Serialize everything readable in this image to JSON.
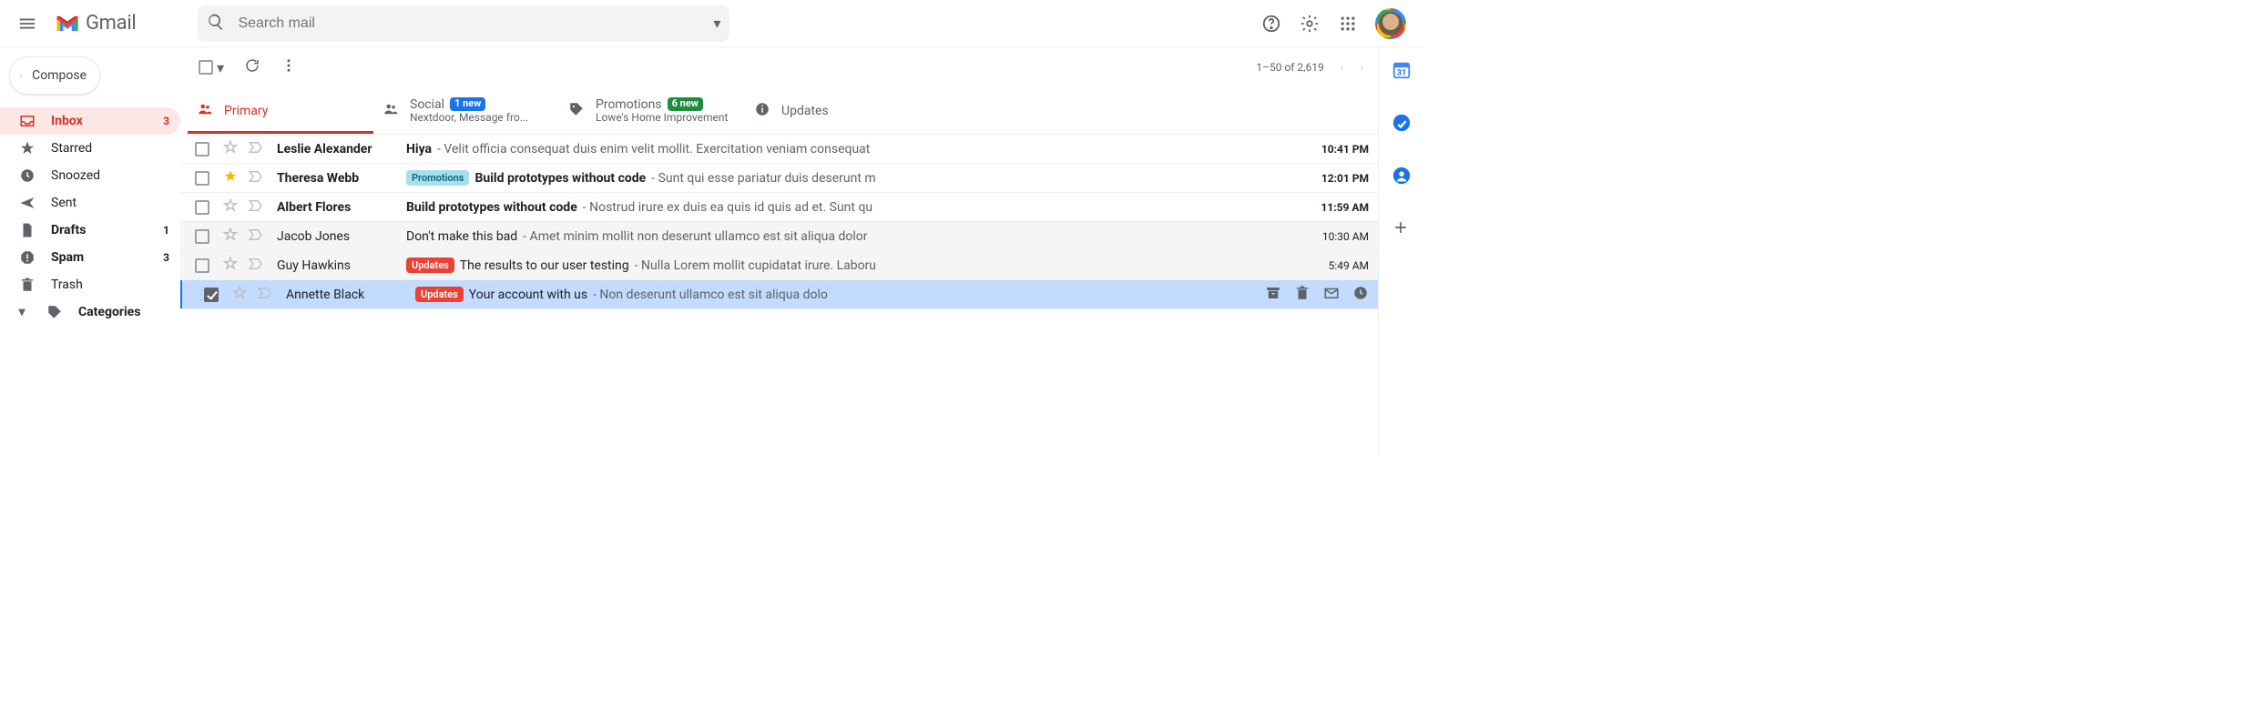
{
  "header": {
    "brand": "Gmail",
    "search_placeholder": "Search mail"
  },
  "sidebar": {
    "compose_label": "Compose",
    "items": [
      {
        "label": "Inbox",
        "count": "3"
      },
      {
        "label": "Starred",
        "count": ""
      },
      {
        "label": "Snoozed",
        "count": ""
      },
      {
        "label": "Sent",
        "count": ""
      },
      {
        "label": "Drafts",
        "count": "1"
      },
      {
        "label": "Spam",
        "count": "3"
      },
      {
        "label": "Trash",
        "count": ""
      },
      {
        "label": "Categories",
        "count": ""
      }
    ]
  },
  "toolbar": {
    "range": "1–50 of 2,619"
  },
  "tabs": {
    "primary": "Primary",
    "social": {
      "title": "Social",
      "badge": "1 new",
      "sub": "Nextdoor, Message fro..."
    },
    "promotions": {
      "title": "Promotions",
      "badge": "6 new",
      "sub": "Lowe's Home Improvement"
    },
    "updates": "Updates"
  },
  "emails": [
    {
      "sender": "Leslie Alexander",
      "chip": "",
      "subject": "Hiya",
      "snippet": " - Velit officia consequat duis enim velit mollit. Exercitation veniam consequat",
      "time": "10:41 PM"
    },
    {
      "sender": "Theresa Webb",
      "chip": "Promotions",
      "subject": "Build prototypes without code",
      "snippet": " - Sunt qui esse pariatur duis deserunt m",
      "time": "12:01 PM"
    },
    {
      "sender": "Albert Flores",
      "chip": "",
      "subject": "Build prototypes without code",
      "snippet": " - Nostrud irure ex duis ea quis id quis ad et. Sunt qu",
      "time": "11:59 AM"
    },
    {
      "sender": "Jacob Jones",
      "chip": "",
      "subject": "Don't make this bad",
      "snippet": " - Amet minim mollit non deserunt ullamco est sit aliqua dolor",
      "time": "10:30 AM"
    },
    {
      "sender": "Guy Hawkins",
      "chip": "Updates",
      "subject": "The results to our user testing",
      "snippet": " - Nulla Lorem mollit cupidatat irure. Laboru",
      "time": "5:49 AM"
    },
    {
      "sender": "Annette Black",
      "chip": "Updates",
      "subject": "Your account with us",
      "snippet": " - Non deserunt ullamco est sit aliqua dolo",
      "time": ""
    }
  ]
}
